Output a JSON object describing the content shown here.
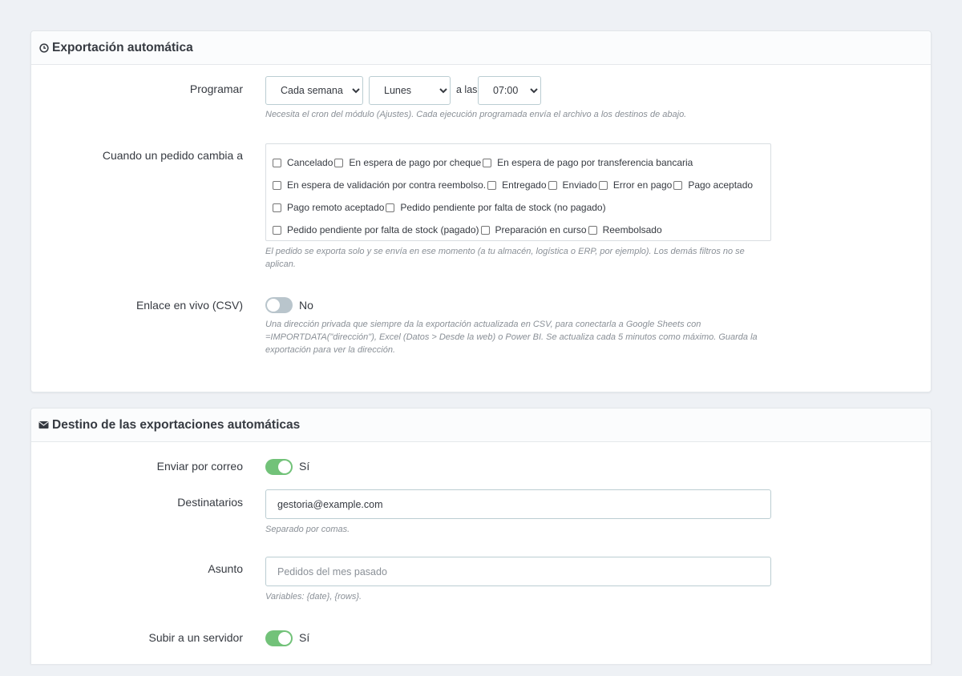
{
  "auto_export": {
    "heading": "Exportación automática",
    "schedule": {
      "label": "Programar",
      "frequency": "Cada semana",
      "day": "Lunes",
      "at_label": "a las",
      "time": "07:00",
      "help": "Necesita el cron del módulo (Ajustes). Cada ejecución programada envía el archivo a los destinos de abajo."
    },
    "status_change": {
      "label": "Cuando un pedido cambia a",
      "lines": [
        [
          "Cancelado",
          "En espera de pago por cheque",
          "En espera de pago por transferencia bancaria"
        ],
        [
          "En espera de validación por contra reembolso.",
          "Entregado",
          "Enviado",
          "Error en pago",
          "Pago aceptado"
        ],
        [
          "Pago remoto aceptado",
          "Pedido pendiente por falta de stock (no pagado)"
        ],
        [
          "Pedido pendiente por falta de stock (pagado)",
          "Preparación en curso",
          "Reembolsado"
        ]
      ],
      "help": "El pedido se exporta solo y se envía en ese momento (a tu almacén, logística o ERP, por ejemplo). Los demás filtros no se aplican."
    },
    "live_link": {
      "label": "Enlace en vivo (CSV)",
      "enabled": false,
      "state_label": "No",
      "help": "Una dirección privada que siempre da la exportación actualizada en CSV, para conectarla a Google Sheets con =IMPORTDATA(\"dirección\"), Excel (Datos > Desde la web) o Power BI. Se actualiza cada 5 minutos como máximo. Guarda la exportación para ver la dirección."
    }
  },
  "destinations": {
    "heading": "Destino de las exportaciones automáticas",
    "email": {
      "label": "Enviar por correo",
      "enabled": true,
      "state_label": "Sí"
    },
    "recipients": {
      "label": "Destinatarios",
      "value": "gestoria@example.com",
      "help": "Separado por comas."
    },
    "subject": {
      "label": "Asunto",
      "placeholder": "Pedidos del mes pasado",
      "help": "Variables: {date}, {rows}."
    },
    "server": {
      "label": "Subir a un servidor",
      "enabled": true,
      "state_label": "Sí"
    }
  }
}
